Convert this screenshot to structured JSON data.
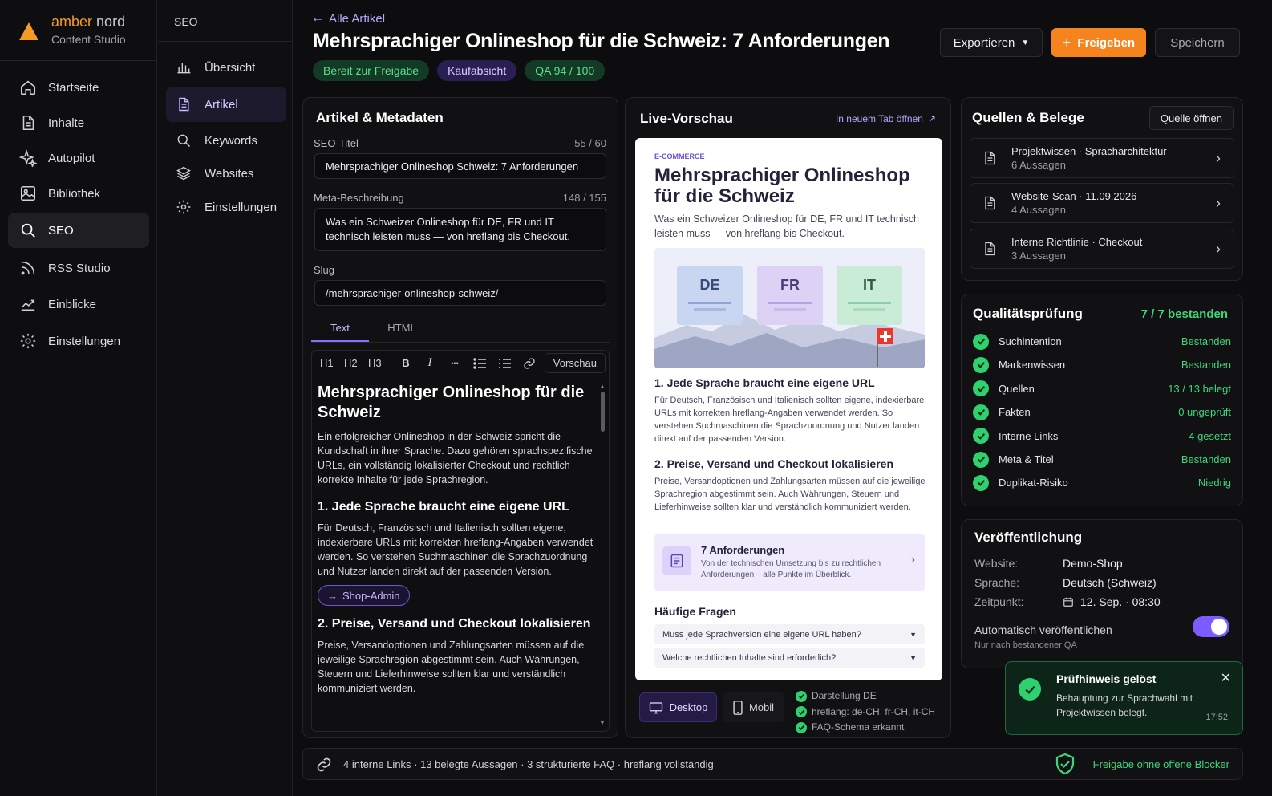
{
  "brand": {
    "name_a": "amber",
    "name_b": "nord",
    "subtitle": "Content Studio",
    "accent": "#f59a23"
  },
  "nav": {
    "items": [
      {
        "label": "Startseite",
        "icon": "home-icon"
      },
      {
        "label": "Inhalte",
        "icon": "document-icon"
      },
      {
        "label": "Autopilot",
        "icon": "sparkle-icon"
      },
      {
        "label": "Bibliothek",
        "icon": "image-icon"
      },
      {
        "label": "SEO",
        "icon": "search-icon",
        "active": true
      },
      {
        "label": "RSS Studio",
        "icon": "rss-icon"
      },
      {
        "label": "Einblicke",
        "icon": "chart-icon"
      },
      {
        "label": "Einstellungen",
        "icon": "gear-icon"
      }
    ]
  },
  "subnav": {
    "title": "SEO",
    "items": [
      {
        "label": "Übersicht",
        "icon": "bar-chart-icon"
      },
      {
        "label": "Artikel",
        "icon": "document-icon",
        "active": true
      },
      {
        "label": "Keywords",
        "icon": "search-icon"
      },
      {
        "label": "Websites",
        "icon": "layers-icon"
      },
      {
        "label": "Einstellungen",
        "icon": "gear-icon"
      }
    ]
  },
  "header": {
    "back": "Alle Artikel",
    "title": "Mehrsprachiger Onlineshop für die Schweiz: 7 Anforderungen",
    "badges": [
      "Bereit zur Freigabe",
      "Kaufabsicht",
      "QA 94 / 100"
    ],
    "export": "Exportieren",
    "release": "Freigeben",
    "save": "Speichern"
  },
  "editor": {
    "panel_title": "Artikel & Metadaten",
    "seo_title_label": "SEO-Titel",
    "seo_title_count": "55 / 60",
    "seo_title_value": "Mehrsprachiger Onlineshop Schweiz: 7 Anforderungen",
    "meta_label": "Meta-Beschreibung",
    "meta_count": "148 / 155",
    "meta_value": "Was ein Schweizer Onlineshop für DE, FR und IT technisch leisten muss — von hreflang bis Checkout.",
    "slug_label": "Slug",
    "slug_value": "/mehrsprachiger-onlineshop-schweiz/",
    "tab_text": "Text",
    "tab_html": "HTML",
    "toolbar": {
      "h1": "H1",
      "h2": "H2",
      "h3": "H3",
      "bold": "B",
      "italic": "I",
      "more": "•••",
      "preview": "Vorschau"
    },
    "content": {
      "h1": "Mehrsprachiger Onlineshop für die Schweiz",
      "intro": "Ein erfolgreicher Onlineshop in der Schweiz spricht die Kundschaft in ihrer Sprache. Dazu gehören sprachspezifische URLs, ein vollständig lokalisierter Checkout und rechtlich korrekte Inhalte für jede Sprachregion.",
      "h2a": "1. Jede Sprache braucht eine eigene URL",
      "p2a": "Für Deutsch, Französisch und Italienisch sollten eigene, indexierbare URLs mit korrekten hreflang-Angaben verwendet werden. So verstehen Suchmaschinen die Sprachzuordnung und Nutzer landen direkt auf der passenden Version.",
      "link_chip": "Shop-Admin",
      "h2b": "2. Preise, Versand und Checkout lokalisieren",
      "p2b": "Preise, Versandoptionen und Zahlungsarten müssen auf die jeweilige Sprachregion abgestimmt sein. Auch Währungen, Steuern und Lieferhinweise sollten klar und verständlich kommuniziert werden."
    }
  },
  "preview": {
    "title": "Live-Vorschau",
    "open_tab": "In neuem Tab öffnen",
    "kicker": "E-COMMERCE",
    "h1": "Mehrsprachiger Onlineshop für die Schweiz",
    "lead": "Was ein Schweizer Onlineshop für DE, FR und IT technisch leisten muss — von hreflang bis Checkout.",
    "langs": [
      "DE",
      "FR",
      "IT"
    ],
    "h2a": "1. Jede Sprache braucht eine eigene URL",
    "p2a": "Für Deutsch, Französisch und Italienisch sollten eigene, indexierbare URLs mit korrekten hreflang-Angaben verwendet werden. So verstehen Suchmaschinen die Sprachzuordnung und Nutzer landen direkt auf der passenden Version.",
    "h2b": "2. Preise, Versand und Checkout lokalisieren",
    "p2b": "Preise, Versandoptionen und Zahlungsarten müssen auf die jeweilige Sprachregion abgestimmt sein. Auch Währungen, Steuern und Lieferhinweise sollten klar und verständlich kommuniziert werden.",
    "card_title": "7 Anforderungen",
    "card_text": "Von der technischen Umsetzung bis zu rechtlichen Anforderungen – alle Punkte im Überblick.",
    "faq_title": "Häufige Fragen",
    "faq": [
      "Muss jede Sprachversion eine eigene URL haben?",
      "Welche rechtlichen Inhalte sind erforderlich?"
    ],
    "desktop": "Desktop",
    "mobile": "Mobil",
    "checks": [
      "Darstellung DE",
      "hreflang: de-CH, fr-CH, it-CH",
      "FAQ-Schema erkannt"
    ]
  },
  "sources": {
    "title": "Quellen & Belege",
    "open": "Quelle öffnen",
    "items": [
      {
        "title": "Projektwissen · Spracharchitektur",
        "sub": "6 Aussagen"
      },
      {
        "title": "Website-Scan · 11.09.2026",
        "sub": "4 Aussagen"
      },
      {
        "title": "Interne Richtlinie · Checkout",
        "sub": "3 Aussagen"
      }
    ]
  },
  "quality": {
    "title": "Qualitätsprüfung",
    "summary": "7 / 7 bestanden",
    "rows": [
      {
        "name": "Suchintention",
        "value": "Bestanden"
      },
      {
        "name": "Markenwissen",
        "value": "Bestanden"
      },
      {
        "name": "Quellen",
        "value": "13 / 13 belegt"
      },
      {
        "name": "Fakten",
        "value": "0 ungeprüft"
      },
      {
        "name": "Interne Links",
        "value": "4 gesetzt"
      },
      {
        "name": "Meta & Titel",
        "value": "Bestanden"
      },
      {
        "name": "Duplikat-Risiko",
        "value": "Niedrig"
      }
    ]
  },
  "publish": {
    "title": "Veröffentlichung",
    "website_label": "Website:",
    "website": "Demo-Shop",
    "lang_label": "Sprache:",
    "lang": "Deutsch (Schweiz)",
    "time_label": "Zeitpunkt:",
    "time": "12. Sep. · 08:30",
    "auto_label": "Automatisch veröffentlichen",
    "auto_note": "Nur nach bestandener QA",
    "auto_on": true
  },
  "toast": {
    "title": "Prüfhinweis gelöst",
    "text": "Behauptung zur Sprachwahl mit Projektwissen belegt.",
    "time": "17:52"
  },
  "footer": {
    "stats": "4 interne Links · 13 belegte Aussagen · 3 strukturierte FAQ · hreflang vollständig",
    "status": "Freigabe ohne offene Blocker"
  },
  "colors": {
    "accent": "#f59a23",
    "green": "#3fd57b",
    "purple": "#7c5cff"
  }
}
